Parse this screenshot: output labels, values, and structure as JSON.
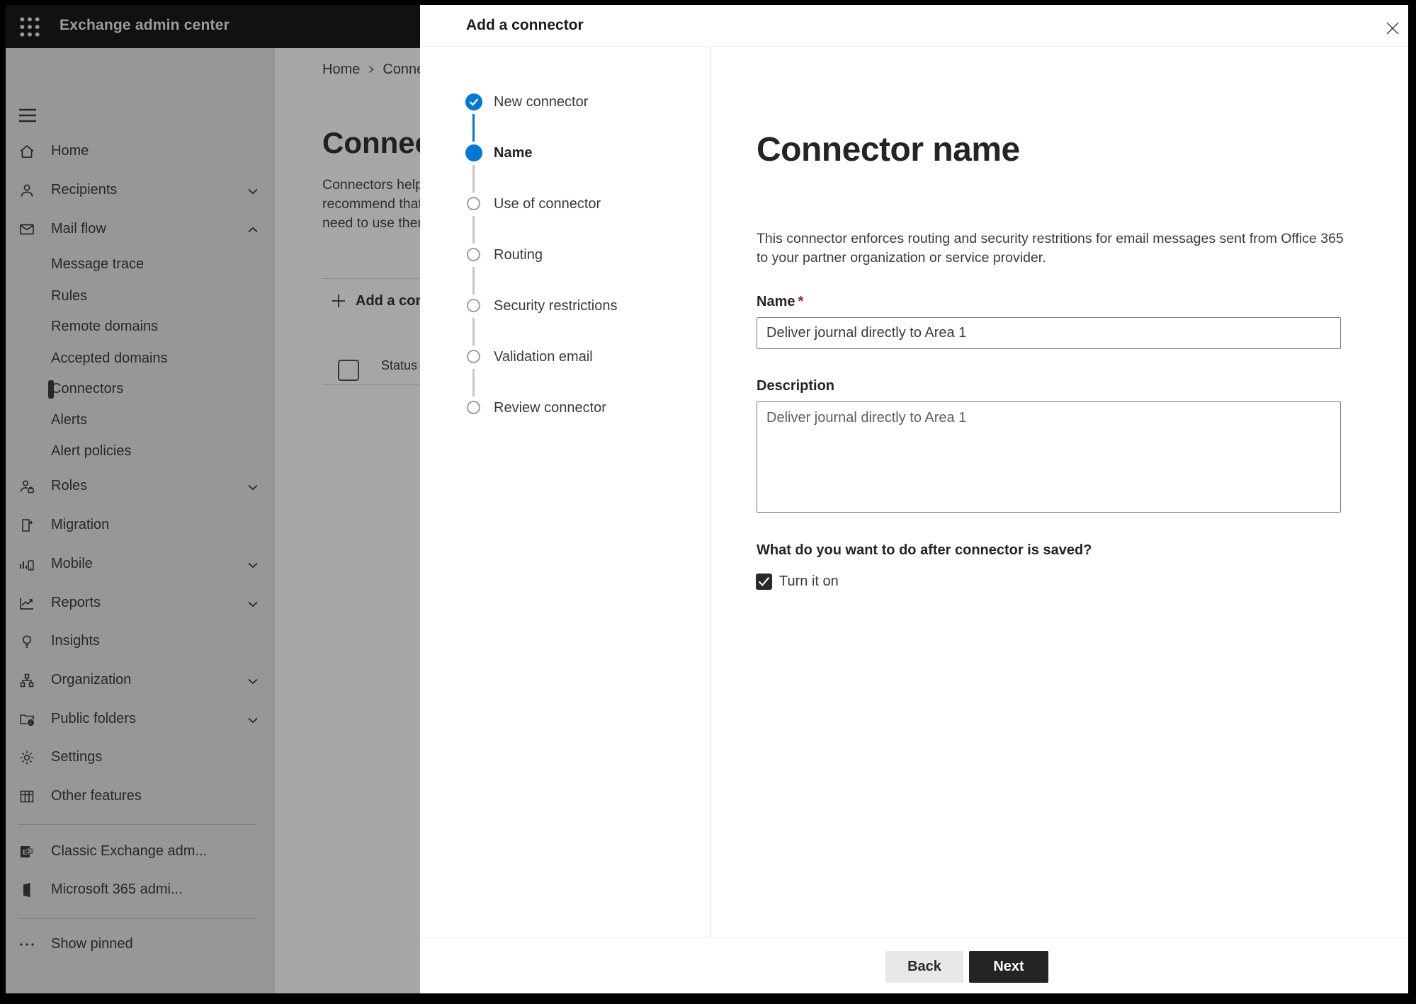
{
  "header": {
    "title": "Exchange admin center"
  },
  "sidebar": {
    "items": [
      {
        "label": "Home"
      },
      {
        "label": "Recipients"
      },
      {
        "label": "Mail flow"
      },
      {
        "label": "Message trace"
      },
      {
        "label": "Rules"
      },
      {
        "label": "Remote domains"
      },
      {
        "label": "Accepted domains"
      },
      {
        "label": "Connectors"
      },
      {
        "label": "Alerts"
      },
      {
        "label": "Alert policies"
      },
      {
        "label": "Roles"
      },
      {
        "label": "Migration"
      },
      {
        "label": "Mobile"
      },
      {
        "label": "Reports"
      },
      {
        "label": "Insights"
      },
      {
        "label": "Organization"
      },
      {
        "label": "Public folders"
      },
      {
        "label": "Settings"
      },
      {
        "label": "Other features"
      }
    ],
    "footer_items": [
      {
        "label": "Classic Exchange adm..."
      },
      {
        "label": "Microsoft 365 admi..."
      }
    ],
    "show_pinned": "Show pinned"
  },
  "page": {
    "breadcrumb": {
      "home": "Home",
      "current": "Conne"
    },
    "title": "Connec",
    "description_lines": [
      "Connectors help",
      "recommend that",
      "need to use ther"
    ],
    "add_button": "Add a conn",
    "table": {
      "status_column": "Status"
    }
  },
  "modal": {
    "title": "Add a connector",
    "steps": [
      {
        "label": "New connector",
        "state": "completed"
      },
      {
        "label": "Name",
        "state": "current"
      },
      {
        "label": "Use of connector",
        "state": "upcoming"
      },
      {
        "label": "Routing",
        "state": "upcoming"
      },
      {
        "label": "Security restrictions",
        "state": "upcoming"
      },
      {
        "label": "Validation email",
        "state": "upcoming"
      },
      {
        "label": "Review connector",
        "state": "upcoming"
      }
    ],
    "content": {
      "title": "Connector name",
      "intro_line1": "This connector enforces routing and security restritions for email messages sent from Office 365",
      "intro_line2": "to your partner organization or service provider.",
      "name_label": "Name",
      "required_marker": "*",
      "name_value": "Deliver journal directly to Area 1",
      "description_label": "Description",
      "description_value": "Deliver journal directly to Area 1",
      "after_save_question": "What do you want to do after connector is saved?",
      "turn_on_label": "Turn it on",
      "back_label": "Back",
      "next_label": "Next"
    },
    "colors": {
      "accent": "#0078d4",
      "primary_button": "#252423",
      "required": "#a4262c"
    }
  }
}
